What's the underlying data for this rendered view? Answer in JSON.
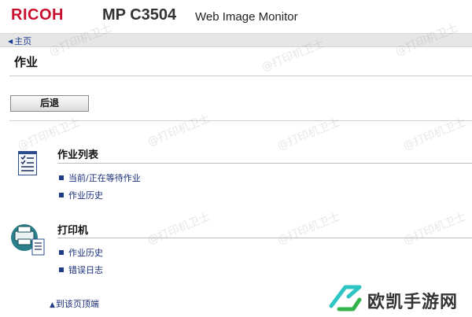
{
  "header": {
    "brand": "RICOH",
    "model": "MP C3504",
    "subtitle": "Web Image Monitor"
  },
  "breadcrumb": {
    "home_label": "主页"
  },
  "page": {
    "title": "作业",
    "back_button": "后退"
  },
  "sections": {
    "job_list": {
      "title": "作业列表",
      "links": [
        "当前/正在等待作业",
        "作业历史"
      ]
    },
    "printer": {
      "title": "打印机",
      "links": [
        "作业历史",
        "错误日志"
      ]
    }
  },
  "footer": {
    "to_top": "到该页顶端"
  },
  "watermark": {
    "text": "@打印机卫士"
  },
  "corner_logo": {
    "text": "欧凯手游网"
  },
  "colors": {
    "brand_red": "#c8102e",
    "link_blue": "#1a2f7a",
    "breadcrumb_bg": "#e6e6e6",
    "icon_teal": "#1e6f7a"
  },
  "icons": {
    "job_list": "job-list-icon",
    "printer": "printer-icon",
    "breadcrumb_arrow": "triangle-left-icon",
    "to_top_arrow": "triangle-up-icon"
  }
}
